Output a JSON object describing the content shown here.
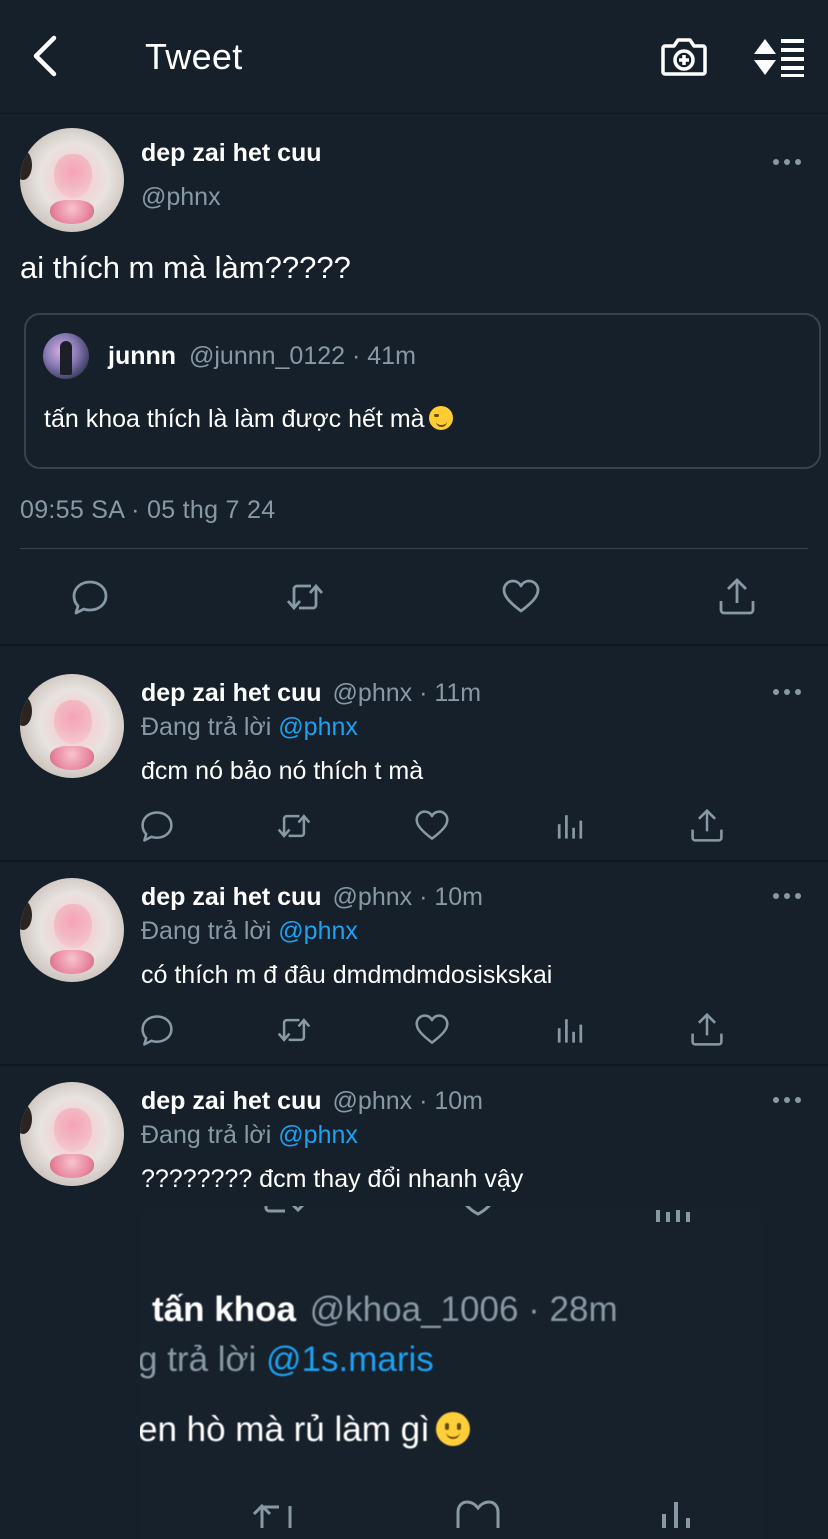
{
  "header": {
    "title": "Tweet"
  },
  "main_tweet": {
    "display_name": "dep zai het cuu",
    "handle": "@phnx",
    "text": "ai thích m mà làm?????",
    "quote": {
      "display_name": "junnn",
      "handle_time": "@junnn_0122 · 41m",
      "text": "tấn khoa thích là làm được hết mà"
    },
    "timestamp": "09:55 SA · 05 thg 7 24"
  },
  "replies": [
    {
      "display_name": "dep zai het cuu",
      "meta": "@phnx · 11m",
      "replying_prefix": "Đang trả lời",
      "replying_to": "@phnx",
      "text": "đcm nó bảo nó thích t mà"
    },
    {
      "display_name": "dep zai het cuu",
      "meta": "@phnx · 10m",
      "replying_prefix": "Đang trả lời",
      "replying_to": "@phnx",
      "text": "có thích m đ đâu dmdmdmdosiskskai"
    },
    {
      "display_name": "dep zai het cuu",
      "meta": "@phnx · 10m",
      "replying_prefix": "Đang trả lời",
      "replying_to": "@phnx",
      "text": "???????? đcm thay đổi nhanh vậy"
    }
  ],
  "embedded_screenshot": {
    "display_name": "tấn khoa",
    "meta": "@khoa_1006 · 28m",
    "replying_prefix": "g trả lời",
    "replying_to": "@1s.maris",
    "text": "en hò mà rủ làm gì"
  },
  "colors": {
    "background": "#15202b",
    "text": "#ffffff",
    "muted": "#8899a6",
    "accent": "#1da1f2",
    "border": "#38444d"
  },
  "icons": [
    "back-arrow-icon",
    "camera-plus-icon",
    "sort-icon",
    "more-icon",
    "reply-icon",
    "retweet-icon",
    "like-icon",
    "analytics-icon",
    "share-icon"
  ]
}
